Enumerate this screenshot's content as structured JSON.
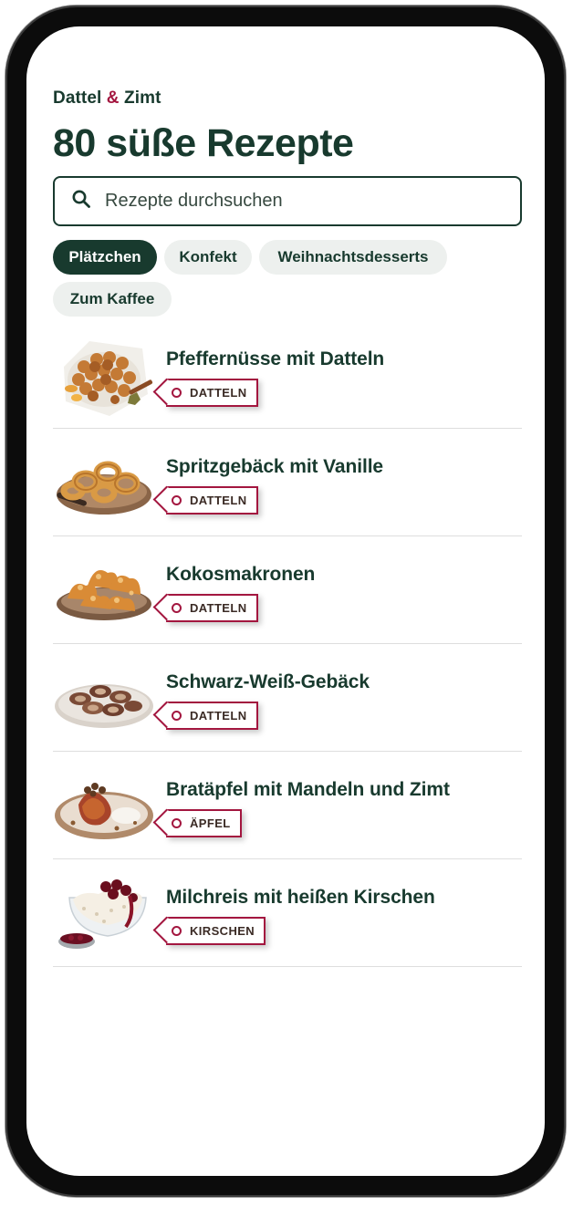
{
  "header": {
    "brand_part1": "Dattel",
    "brand_amp": "&",
    "brand_part2": "Zimt",
    "title": "80 süße Rezepte"
  },
  "search": {
    "placeholder": "Rezepte durchsuchen",
    "icon": "search-icon"
  },
  "filters": [
    {
      "label": "Plätzchen",
      "active": true
    },
    {
      "label": "Konfekt",
      "active": false
    },
    {
      "label": "Weihnachtsdesserts",
      "active": false
    },
    {
      "label": "Zum Kaffee",
      "active": false
    }
  ],
  "recipes": [
    {
      "title": "Pfeffernüsse mit Datteln",
      "tag": "DATTELN"
    },
    {
      "title": "Spritzgebäck mit Vanille",
      "tag": "DATTELN"
    },
    {
      "title": "Kokosmakronen",
      "tag": "DATTELN"
    },
    {
      "title": "Schwarz-Weiß-Gebäck",
      "tag": "DATTELN"
    },
    {
      "title": "Bratäpfel mit Mandeln und Zimt",
      "tag": "ÄPFEL"
    },
    {
      "title": "Milchreis mit heißen Kirschen",
      "tag": "KIRSCHEN"
    }
  ],
  "colors": {
    "primary": "#183a2e",
    "accent": "#a3163f",
    "chip_bg": "#edf0ee",
    "divider": "#dedede"
  }
}
